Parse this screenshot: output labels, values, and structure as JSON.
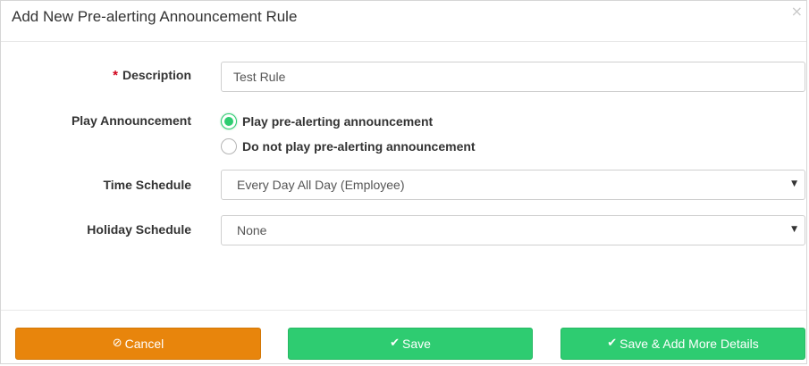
{
  "dialog": {
    "title": "Add New Pre-alerting Announcement Rule",
    "close_glyph": "×"
  },
  "form": {
    "description": {
      "required_marker": "*",
      "label": "Description",
      "value": "Test Rule"
    },
    "play_announcement": {
      "label": "Play Announcement",
      "options": [
        {
          "label": "Play pre-alerting announcement",
          "checked": true
        },
        {
          "label": "Do not play pre-alerting announcement",
          "checked": false
        }
      ]
    },
    "time_schedule": {
      "label": "Time Schedule",
      "selected": "Every Day All Day (Employee)",
      "caret": "▼"
    },
    "holiday_schedule": {
      "label": "Holiday Schedule",
      "selected": "None",
      "caret": "▼"
    }
  },
  "footer": {
    "cancel": {
      "icon": "⊘",
      "label": "Cancel"
    },
    "save": {
      "icon": "✔",
      "label": "Save"
    },
    "save_more": {
      "icon": "✔",
      "label": "Save & Add More Details"
    }
  },
  "colors": {
    "cancel_bg": "#e8850c",
    "save_bg": "#2ecc71",
    "required_star": "#d0021b"
  }
}
